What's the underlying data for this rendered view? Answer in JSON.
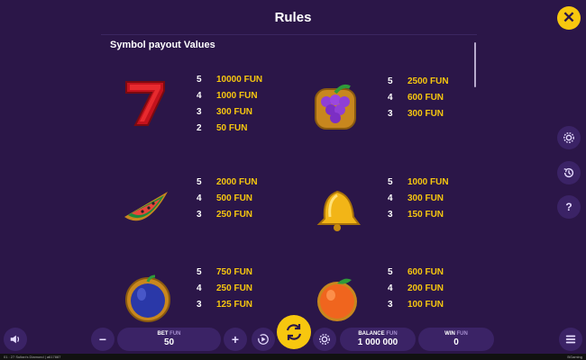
{
  "header": {
    "title": "Rules",
    "close": "✕"
  },
  "rules": {
    "section_title": "Symbol payout Values",
    "symbols": [
      {
        "icon": "seven-icon",
        "payouts": [
          {
            "count": "5",
            "value": "10000 FUN"
          },
          {
            "count": "4",
            "value": "1000 FUN"
          },
          {
            "count": "3",
            "value": "300 FUN"
          },
          {
            "count": "2",
            "value": "50 FUN"
          }
        ]
      },
      {
        "icon": "grapes-icon",
        "payouts": [
          {
            "count": "5",
            "value": "2500 FUN"
          },
          {
            "count": "4",
            "value": "600 FUN"
          },
          {
            "count": "3",
            "value": "300 FUN"
          }
        ]
      },
      {
        "icon": "watermelon-icon",
        "payouts": [
          {
            "count": "5",
            "value": "2000 FUN"
          },
          {
            "count": "4",
            "value": "500 FUN"
          },
          {
            "count": "3",
            "value": "250 FUN"
          }
        ]
      },
      {
        "icon": "bell-icon",
        "payouts": [
          {
            "count": "5",
            "value": "1000 FUN"
          },
          {
            "count": "4",
            "value": "300 FUN"
          },
          {
            "count": "3",
            "value": "150 FUN"
          }
        ]
      },
      {
        "icon": "plum-icon",
        "payouts": [
          {
            "count": "5",
            "value": "750 FUN"
          },
          {
            "count": "4",
            "value": "250 FUN"
          },
          {
            "count": "3",
            "value": "125 FUN"
          }
        ]
      },
      {
        "icon": "orange-icon",
        "payouts": [
          {
            "count": "5",
            "value": "600 FUN"
          },
          {
            "count": "4",
            "value": "200 FUN"
          },
          {
            "count": "3",
            "value": "100 FUN"
          }
        ]
      }
    ]
  },
  "sidebar": {
    "help": "?"
  },
  "bottom_bar": {
    "minus": "−",
    "plus": "+",
    "bet_label": "BET",
    "bet_unit": "FUN",
    "bet_value": "50",
    "balance_label": "BALANCE",
    "balance_unit": "FUN",
    "balance_value": "1 000 000",
    "win_label": "WIN",
    "win_unit": "FUN",
    "win_value": "0"
  },
  "status": {
    "left": "01 : 27   Sultan's Diamond | a617887",
    "right": "BGaming"
  },
  "colors": {
    "background": "#2b1648",
    "accent": "#f7c70f",
    "button": "#3b2366"
  }
}
